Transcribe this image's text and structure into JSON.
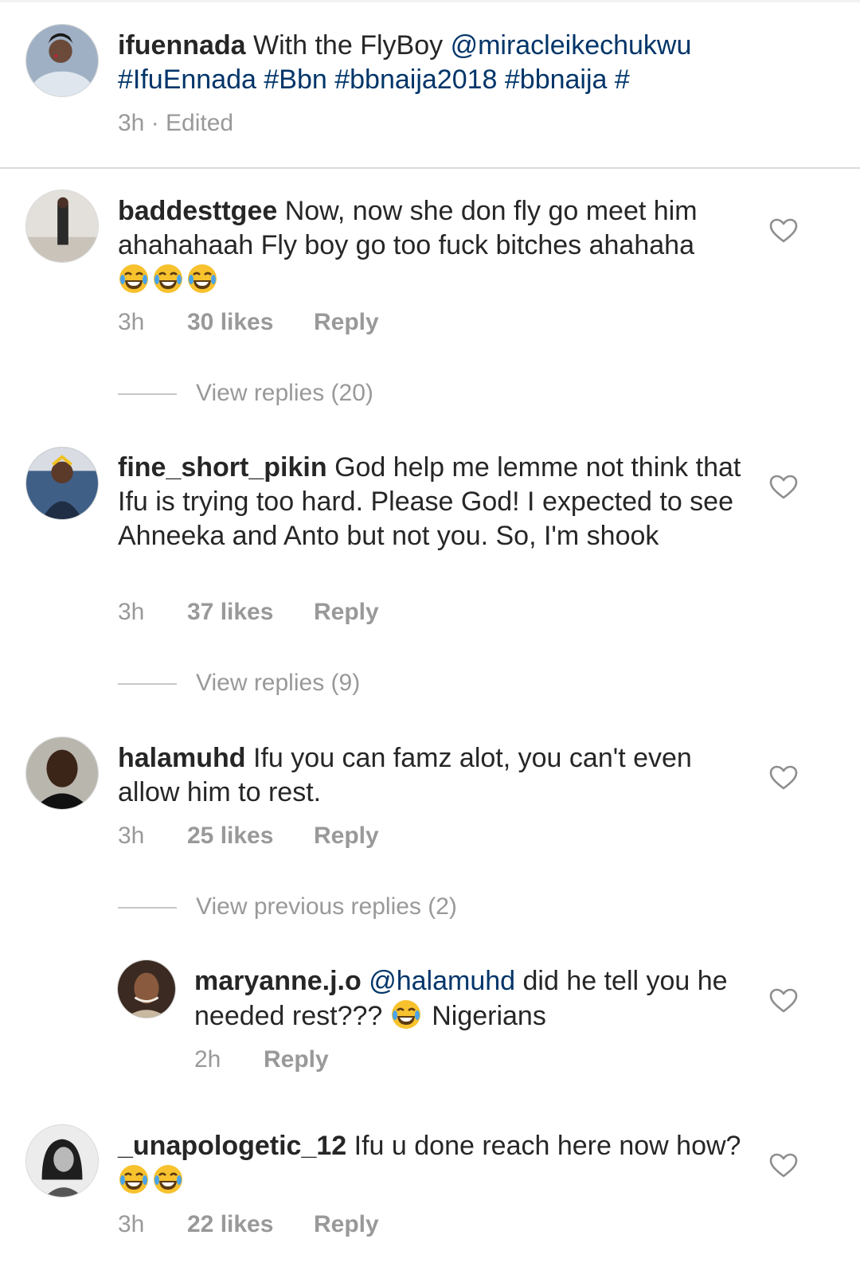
{
  "colors": {
    "text": "#262626",
    "link": "#003569",
    "muted": "#999999",
    "divider": "#dbdbdb"
  },
  "caption": {
    "username": "ifuennada",
    "text": "With the FlyBoy",
    "mention": "@miracleikechukwu",
    "hashtags": "#IfuEnnada #Bbn #bbnaija2018 #bbnaija #",
    "meta": "3h · Edited"
  },
  "comments": [
    {
      "username": "baddesttgee",
      "text": "Now, now she don fly go meet him ahahahaah Fly boy go too fuck bitches ahahaha",
      "emoji": "face-with-tears-of-joy ×3",
      "time": "3h",
      "likes": "30 likes",
      "reply": "Reply",
      "view_replies": "View replies (20)"
    },
    {
      "username": "fine_short_pikin",
      "text": "God help me lemme not think that Ifu is trying too hard. Please God! I expected to see Ahneeka and Anto but not you. So, I'm shook",
      "time": "3h",
      "likes": "37 likes",
      "reply": "Reply",
      "view_replies": "View replies (9)"
    },
    {
      "username": "halamuhd",
      "text": "Ifu you can famz alot, you can't even allow him to rest.",
      "time": "3h",
      "likes": "25 likes",
      "reply": "Reply",
      "view_replies": "View previous replies (2)"
    },
    {
      "username": "maryanne.j.o",
      "mention": "@halamuhd",
      "text_before": "did he tell you he needed rest???",
      "text_after": "Nigerians",
      "time": "2h",
      "reply": "Reply"
    },
    {
      "username": "_unapologetic_12",
      "text": "Ifu u done reach here now how?",
      "emoji": "face-with-tears-of-joy ×2",
      "time": "3h",
      "likes": "22 likes",
      "reply": "Reply"
    }
  ]
}
